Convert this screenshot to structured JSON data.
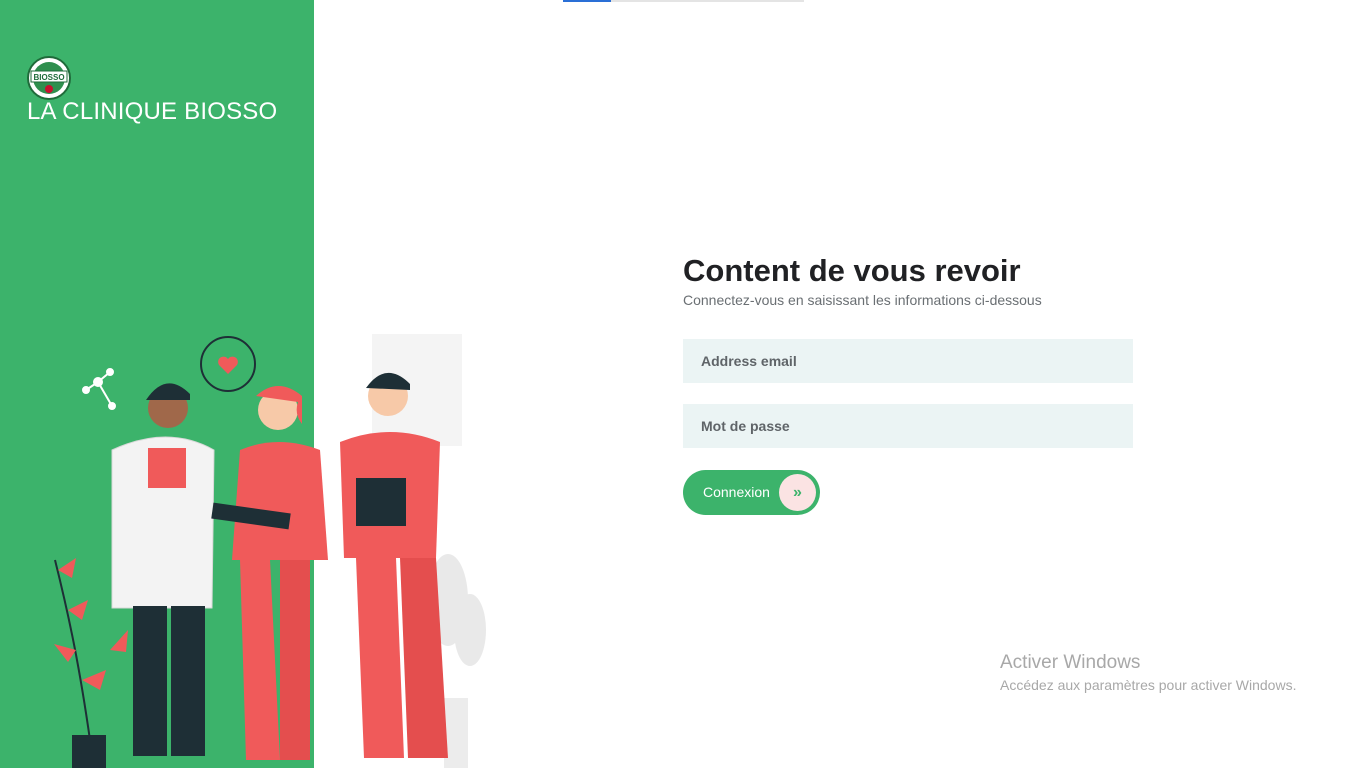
{
  "brand": {
    "name": "LA CLINIQUE BIOSSO",
    "logo_text": "BIOSSO"
  },
  "progress": {
    "fraction": 0.2
  },
  "login": {
    "title": "Content de vous revoir",
    "subtitle": "Connectez-vous en saisissant les informations ci-dessous",
    "email_placeholder": "Address email",
    "password_placeholder": "Mot de passe",
    "submit_label": "Connexion",
    "submit_icon": "double-chevron-right-icon"
  },
  "watermark": {
    "title": "Activer Windows",
    "subtitle": "Accédez aux paramètres pour activer Windows."
  },
  "colors": {
    "brand_green": "#3cb36b",
    "field_bg": "#ebf4f4",
    "scrub_red": "#f05a5a",
    "button_circle": "#fbe3e3"
  }
}
